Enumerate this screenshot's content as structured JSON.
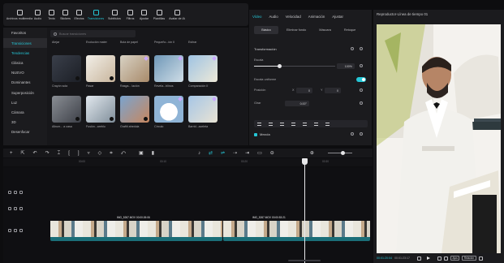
{
  "toolbar": {
    "items": [
      {
        "label": "Archivos multimedia",
        "icon": "media-icon"
      },
      {
        "label": "Audio",
        "icon": "audio-icon"
      },
      {
        "label": "Texto",
        "icon": "text-icon"
      },
      {
        "label": "Stickers",
        "icon": "sticker-icon"
      },
      {
        "label": "Efectos",
        "icon": "effects-icon"
      },
      {
        "label": "Transiciones",
        "icon": "transitions-icon",
        "active": true
      },
      {
        "label": "Subtítulos",
        "icon": "subtitles-icon"
      },
      {
        "label": "Filtros",
        "icon": "filters-icon"
      },
      {
        "label": "Ajustar",
        "icon": "adjust-icon"
      },
      {
        "label": "Plantillas",
        "icon": "templates-icon"
      },
      {
        "label": "Avatar de IA",
        "icon": "ai-avatar-icon"
      }
    ]
  },
  "leftnav": {
    "items": [
      "Favoritos",
      "Transiciones",
      "Tendencias",
      "Clásica",
      "NUEVO",
      "Dominantes",
      "Superposición",
      "Luz",
      "Cámara",
      "3D",
      "Desenfocar"
    ],
    "selected_index": 1,
    "active_index": 2
  },
  "effects": {
    "search_placeholder": "Buscar transiciones",
    "row0_labels": [
      "Alejar",
      "Evolución mater",
      "Bola de papel",
      "Pequeño...ión II",
      "Estirar"
    ],
    "rows": [
      [
        {
          "label": "Crayón sola"
        },
        {
          "label": "Pasar"
        },
        {
          "label": "Rasga... lación"
        },
        {
          "label": "Revela...blinos"
        },
        {
          "label": "Comparación II"
        }
      ],
      [
        {
          "label": "Album... a casa"
        },
        {
          "label": "Fusión...areblu"
        },
        {
          "label": "Grafiti ahedula"
        },
        {
          "label": "Círculo"
        },
        {
          "label": "Barrid...aceleta"
        }
      ]
    ]
  },
  "props": {
    "tabs": [
      "Vídeo",
      "Audio",
      "Velocidad",
      "Animación",
      "Ajustar"
    ],
    "active_tab": 0,
    "subtabs": [
      "Básico",
      "Eliminar fondo",
      "Máscara",
      "Retoque"
    ],
    "active_subtab": 0,
    "transform_label": "Transformación",
    "scale_label": "Escala",
    "scale_value": "100%",
    "scale_fraction": 0.3,
    "uniform_label": "Escala uniforme",
    "uniform_on": true,
    "position_label": "Posición",
    "pos_x_label": "X",
    "pos_x": "0",
    "pos_y_label": "Y",
    "pos_y": "0",
    "rotate_label": "Girar",
    "rotate_value": "0.00°",
    "mix_label": "Mezcla"
  },
  "player": {
    "title": "Reproductor-Línea de tiempo 01",
    "time_current": "00:01:20:04",
    "time_total": "00:01:23:17",
    "badges": [
      "Ajus",
      "Relación"
    ]
  },
  "timeline": {
    "ruler": [
      "00:00",
      "00:10",
      "00:20",
      "00:30",
      "00:40"
    ],
    "clips": [
      {
        "name": "IMG_5267.MOV  00:00:26:06"
      },
      {
        "name": "IMG_5267.MOV  00:00:53:21"
      }
    ]
  },
  "colors": {
    "accent": "#25c6d6",
    "bg": "#0d0d0f",
    "panel": "#1b1b1e"
  }
}
